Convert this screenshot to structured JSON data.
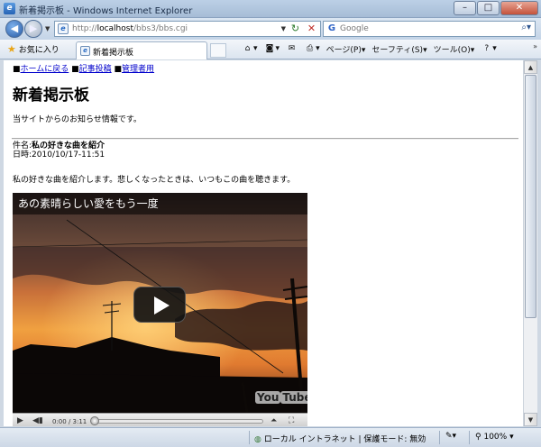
{
  "window": {
    "title": "新着掲示板 - Windows Internet Explorer",
    "minimize_glyph": "–",
    "maximize_glyph": "□",
    "close_glyph": "✕"
  },
  "address_bar": {
    "url_prefix": "http://",
    "url_host": "localhost",
    "url_path": "/bbs3/bbs.cgi",
    "search_placeholder": "Google"
  },
  "command_bar": {
    "favorites_label": "お気に入り",
    "tab_title": "新着掲示板",
    "tools": {
      "page_label": "ページ(P)",
      "safety_label": "セーフティ(S)",
      "tools_label": "ツール(O)"
    }
  },
  "page": {
    "nav": [
      {
        "marker": "■",
        "label": "ホームに戻る"
      },
      {
        "marker": "■",
        "label": "記事投稿"
      },
      {
        "marker": "■",
        "label": "管理者用"
      }
    ],
    "heading": "新着掲示板",
    "intro": "当サイトからのお知らせ情報です。",
    "post": {
      "subject_label": "件名:",
      "subject": "私の好きな曲を紹介",
      "date_label": "日時:",
      "date": "2010/10/17-11:51",
      "body": "私の好きな曲を紹介します。悲しくなったときは、いつもこの曲を聴きます。",
      "video": {
        "title": "あの素晴らしい愛をもう一度",
        "time": "0:00 / 3:11",
        "logo_you": "You",
        "logo_tube": "Tube",
        "progress": 0
      }
    }
  },
  "status_bar": {
    "zone": "ローカル イントラネット | 保護モード: 無効",
    "zoom": "100%"
  }
}
